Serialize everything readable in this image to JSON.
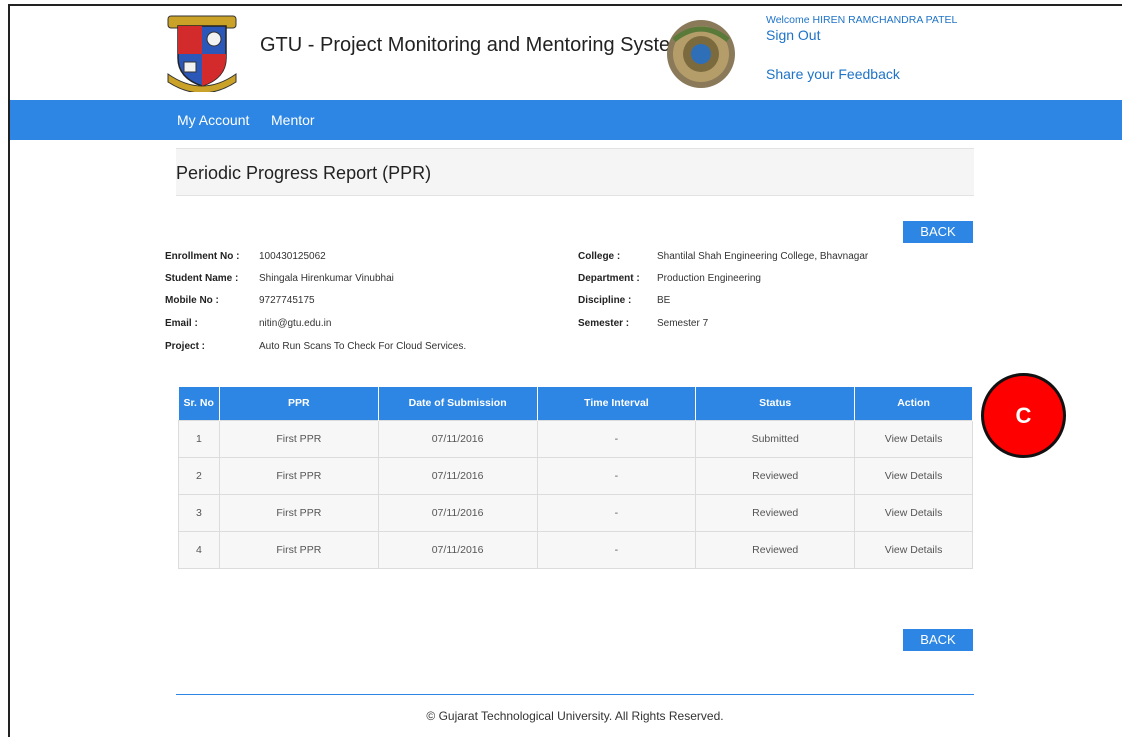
{
  "header": {
    "site_title": "GTU - Project Monitoring and Mentoring System",
    "welcome": "Welcome HIREN RAMCHANDRA PATEL",
    "sign_out": "Sign Out",
    "feedback": "Share your Feedback",
    "left_logo_icon": "gtu-crest-icon",
    "right_logo_icon": "innovation-council-logo-icon"
  },
  "nav": {
    "items": [
      {
        "label": "My Account"
      },
      {
        "label": "Mentor"
      }
    ]
  },
  "page": {
    "title": "Periodic Progress Report (PPR)",
    "back_label": "BACK"
  },
  "student": {
    "enrollment_label": "Enrollment No :",
    "enrollment_value": "100430125062",
    "name_label": "Student Name :",
    "name_value": "Shingala Hirenkumar Vinubhai",
    "mobile_label": "Mobile No :",
    "mobile_value": "9727745175",
    "email_label": "Email :",
    "email_value": "nitin@gtu.edu.in",
    "project_label": "Project :",
    "project_value": "Auto Run Scans To Check For Cloud Services.",
    "college_label": "College :",
    "college_value": "Shantilal Shah Engineering College, Bhavnagar",
    "department_label": "Department :",
    "department_value": "Production Engineering",
    "discipline_label": "Discipline :",
    "discipline_value": "BE",
    "semester_label": "Semester :",
    "semester_value": "Semester 7"
  },
  "table": {
    "headers": [
      "Sr. No",
      "PPR",
      "Date of Submission",
      "Time Interval",
      "Status",
      "Action"
    ],
    "rows": [
      {
        "sr": "1",
        "ppr": "First PPR",
        "date": "07/11/2016",
        "interval": "-",
        "status": "Submitted",
        "action": "View Details"
      },
      {
        "sr": "2",
        "ppr": "First PPR",
        "date": "07/11/2016",
        "interval": "-",
        "status": "Reviewed",
        "action": "View Details"
      },
      {
        "sr": "3",
        "ppr": "First PPR",
        "date": "07/11/2016",
        "interval": "-",
        "status": "Reviewed",
        "action": "View Details"
      },
      {
        "sr": "4",
        "ppr": "First PPR",
        "date": "07/11/2016",
        "interval": "-",
        "status": "Reviewed",
        "action": "View Details"
      }
    ]
  },
  "annotation": {
    "label": "C",
    "color": "#ff0000"
  },
  "footer": {
    "text": "© Gujarat Technological University. All Rights Reserved."
  },
  "colors": {
    "accent": "#2d86e3",
    "submitted": "#d9251c",
    "reviewed": "#3c8c2e",
    "link": "#1e73c8"
  }
}
